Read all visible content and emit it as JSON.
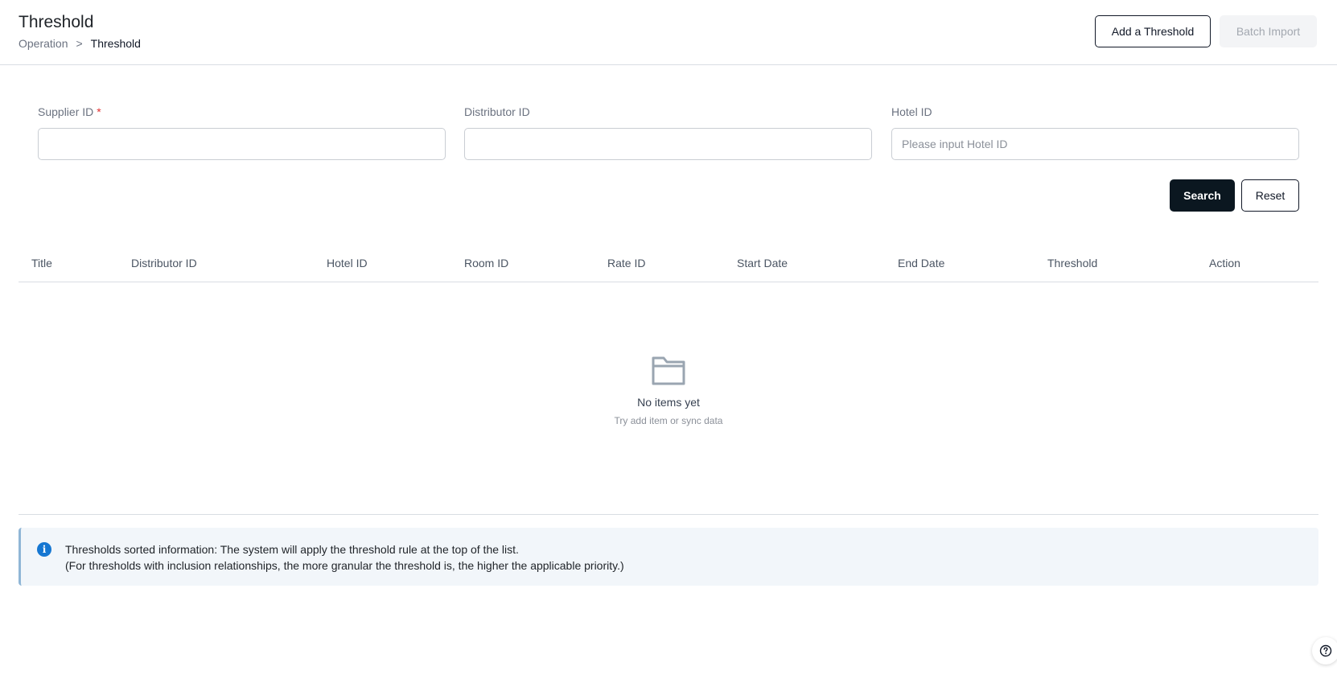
{
  "header": {
    "title": "Threshold",
    "breadcrumb": {
      "parent": "Operation",
      "separator": ">",
      "current": "Threshold"
    },
    "add_button": "Add a Threshold",
    "batch_button": "Batch Import"
  },
  "filters": {
    "supplier": {
      "label": "Supplier ID",
      "required_mark": "*",
      "value": "",
      "placeholder": ""
    },
    "distributor": {
      "label": "Distributor ID",
      "value": "",
      "placeholder": ""
    },
    "hotel": {
      "label": "Hotel ID",
      "value": "",
      "placeholder": "Please input Hotel ID"
    },
    "search_button": "Search",
    "reset_button": "Reset"
  },
  "table": {
    "columns": [
      "Title",
      "Distributor ID",
      "Hotel ID",
      "Room ID",
      "Rate ID",
      "Start Date",
      "End Date",
      "Threshold",
      "Action"
    ],
    "rows": []
  },
  "empty_state": {
    "icon": "folder-icon",
    "title": "No items yet",
    "subtitle": "Try add item or sync data"
  },
  "notice": {
    "icon": "info-icon",
    "line1": "Thresholds sorted information: The system will apply the threshold rule at the top of the list.",
    "line2": "(For thresholds with inclusion relationships, the more granular the threshold is, the higher the applicable priority.)"
  },
  "help": {
    "icon": "help-icon"
  },
  "colors": {
    "primary_button": "#0b1720",
    "info_accent": "#1677d2",
    "required": "#e03131"
  }
}
